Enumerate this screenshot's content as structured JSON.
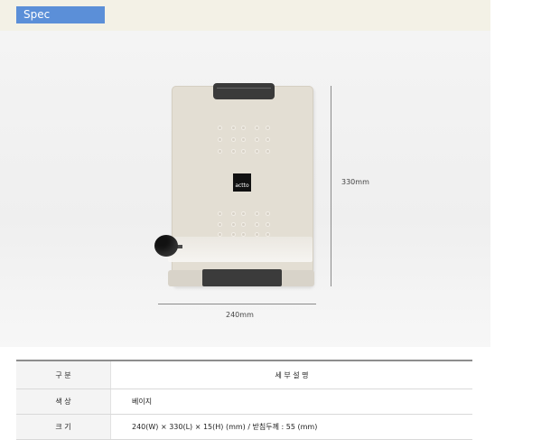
{
  "header": {
    "tab_label": "Spec"
  },
  "product": {
    "logo_text": "actto",
    "height_label": "330mm",
    "width_label": "240mm"
  },
  "spec_table": {
    "columns": [
      "구 분",
      "세 부 설 명"
    ],
    "rows": [
      {
        "label": "색 상",
        "value": "베이지"
      },
      {
        "label": "크 기",
        "value": "240(W) × 330(L) × 15(H) (mm) / 받침두께 : 55 (mm)"
      }
    ]
  },
  "colors": {
    "accent": "#5b8fd8",
    "band": "#f3f1e6",
    "product_body": "#e3ded3",
    "dark_parts": "#3a3a3a"
  }
}
